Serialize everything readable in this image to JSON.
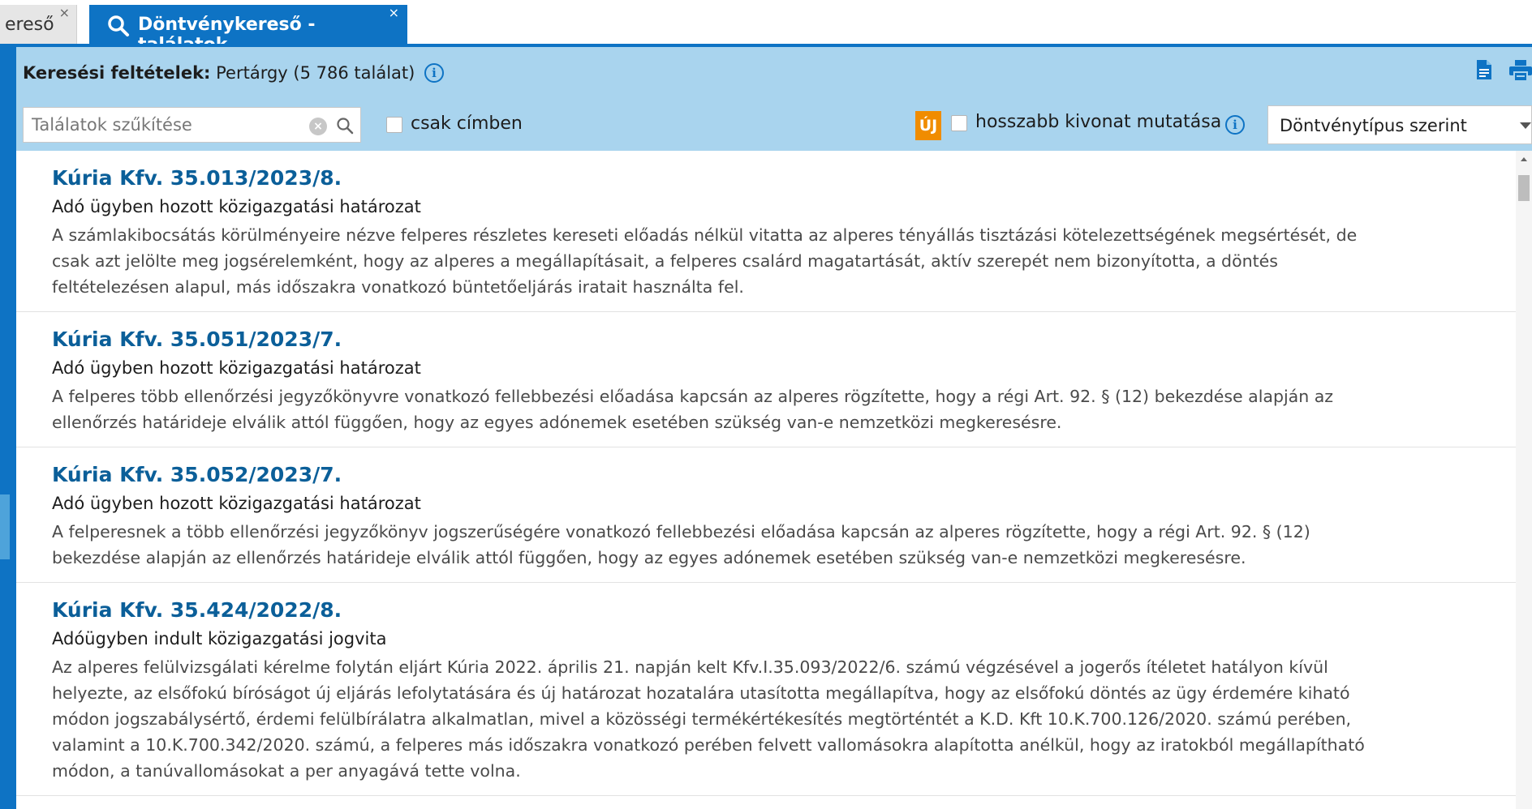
{
  "tabs": [
    {
      "label": "ereső",
      "close": "×"
    },
    {
      "label": "Döntvénykereső - találatok",
      "close": "×"
    }
  ],
  "criteria": {
    "label": "Keresési feltételek:",
    "value": "Pertárgy (5 786 találat)",
    "info_glyph": "i"
  },
  "filter": {
    "placeholder": "Találatok szűkítése",
    "value": "",
    "clear_glyph": "×"
  },
  "options": {
    "title_only_label": "csak címben",
    "title_only_checked": false,
    "new_badge": "ÚJ",
    "longer_excerpt_label": "hosszabb kivonat mutatása",
    "longer_excerpt_checked": false,
    "info_glyph": "i"
  },
  "sort": {
    "selected": "Döntvénytípus szerint"
  },
  "icons": {
    "tab_search": "search-icon",
    "export": "document-icon",
    "print": "print-icon",
    "filter_search": "search-icon"
  },
  "colors": {
    "accent": "#0e73c4",
    "criteria_bg": "#a9d4ee",
    "link": "#0b5f99",
    "new_badge": "#f08c00"
  },
  "results": [
    {
      "title": "Kúria Kfv. 35.013/2023/8.",
      "subtitle": "Adó ügyben hozott közigazgatási határozat",
      "excerpt": "A számlakibocsátás körülményeire nézve felperes részletes kereseti előadás nélkül vitatta az alperes tényállás tisztázási kötelezettségének megsértését, de csak azt jelölte meg jogsérelemként, hogy az alperes a megállapításait, a felperes csalárd magatartását, aktív szerepét nem bizonyította, a döntés feltételezésen alapul, más időszakra vonatkozó büntetőeljárás iratait használta fel."
    },
    {
      "title": "Kúria Kfv. 35.051/2023/7.",
      "subtitle": "Adó ügyben hozott közigazgatási határozat",
      "excerpt": "A felperes több ellenőrzési jegyzőkönyvre vonatkozó fellebbezési előadása kapcsán az alperes rögzítette, hogy a régi Art. 92. § (12) bekezdése alapján az ellenőrzés határideje elválik attól függően, hogy az egyes adónemek esetében szükség van-e nemzetközi megkeresésre."
    },
    {
      "title": "Kúria Kfv. 35.052/2023/7.",
      "subtitle": "Adó ügyben hozott közigazgatási határozat",
      "excerpt": "A felperesnek a több ellenőrzési jegyzőkönyv jogszerűségére vonatkozó fellebbezési előadása kapcsán az alperes rögzítette, hogy a régi Art. 92. § (12) bekezdése alapján az ellenőrzés határideje elválik attól függően, hogy az egyes adónemek esetében szükség van-e nemzetközi megkeresésre."
    },
    {
      "title": "Kúria Kfv. 35.424/2022/8.",
      "subtitle": "Adóügyben indult közigazgatási jogvita",
      "excerpt": "Az alperes felülvizsgálati kérelme folytán eljárt Kúria 2022. április 21. napján kelt Kfv.I.35.093/2022/6. számú végzésével a jogerős ítéletet hatályon kívül helyezte, az elsőfokú bíróságot új eljárás lefolytatására és új határozat hozatalára utasította megállapítva, hogy az elsőfokú döntés az ügy érdemére kiható módon jogszabálysértő, érdemi felülbírálatra alkalmatlan, mivel a közösségi termékértékesítés megtörténtét a K.D. Kft 10.K.700.126/2020. számú perében, valamint a 10.K.700.342/2020. számú, a felperes más időszakra vonatkozó perében felvett vallomásokra alapította anélkül, hogy az iratokból megállapítható módon, a tanúvallomásokat a per anyagává tette volna."
    }
  ]
}
